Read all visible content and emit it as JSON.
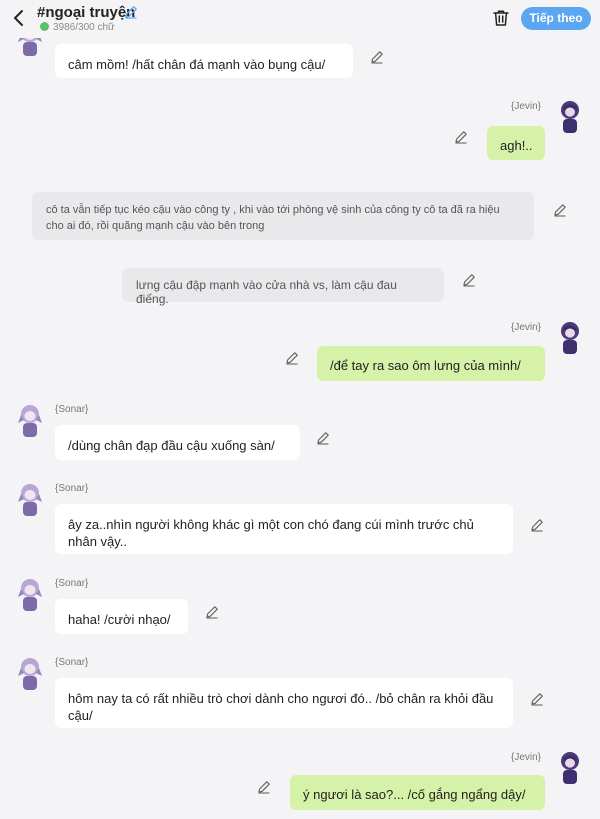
{
  "header": {
    "title": "#ngoại truyện",
    "word_count": "3986/300 chữ",
    "next_button": "Tiếp theo"
  },
  "colors": {
    "accent": "#5aa6f0",
    "bubble_green": "#d6f1a8",
    "bubble_white": "#ffffff",
    "narration_bg": "#e9e9ec",
    "avatar_sonar": "#b8a6d6",
    "avatar_jevin": "#4a3a7a"
  },
  "messages": [
    {
      "speaker": "",
      "text": "câm mồm! /hất chân đá mạnh vào bụng cậu/"
    },
    {
      "speaker": "{Jevin}",
      "text": "agh!.."
    },
    {
      "speaker": "",
      "text": "cô ta vẫn tiếp tục kéo cậu vào công ty , khi vào tới phòng vệ sinh của công ty cô ta đã ra hiệu cho ai đó, rồi quăng mạnh cậu vào bên trong"
    },
    {
      "speaker": "",
      "text": "lưng cậu đập mạnh vào cửa nhà vs, làm cậu đau điếng."
    },
    {
      "speaker": "{Jevin}",
      "text": "/để tay ra sao ôm lưng của mình/"
    },
    {
      "speaker": "{Sonar}",
      "text": "/dùng chân đạp đầu cậu xuống sàn/"
    },
    {
      "speaker": "{Sonar}",
      "text": "ây za..nhìn người không khác gì một con chó đang cúi mình trước chủ nhân vậy.."
    },
    {
      "speaker": "{Sonar}",
      "text": "haha! /cười nhạo/"
    },
    {
      "speaker": "{Sonar}",
      "text": "hôm nay ta có rất nhiều trò chơi dành cho ngươi đó.. /bỏ chân ra khỏi đầu cậu/"
    },
    {
      "speaker": "{Jevin}",
      "text": "ý ngươi là sao?... /cố gắng ngẩng dậy/"
    }
  ]
}
